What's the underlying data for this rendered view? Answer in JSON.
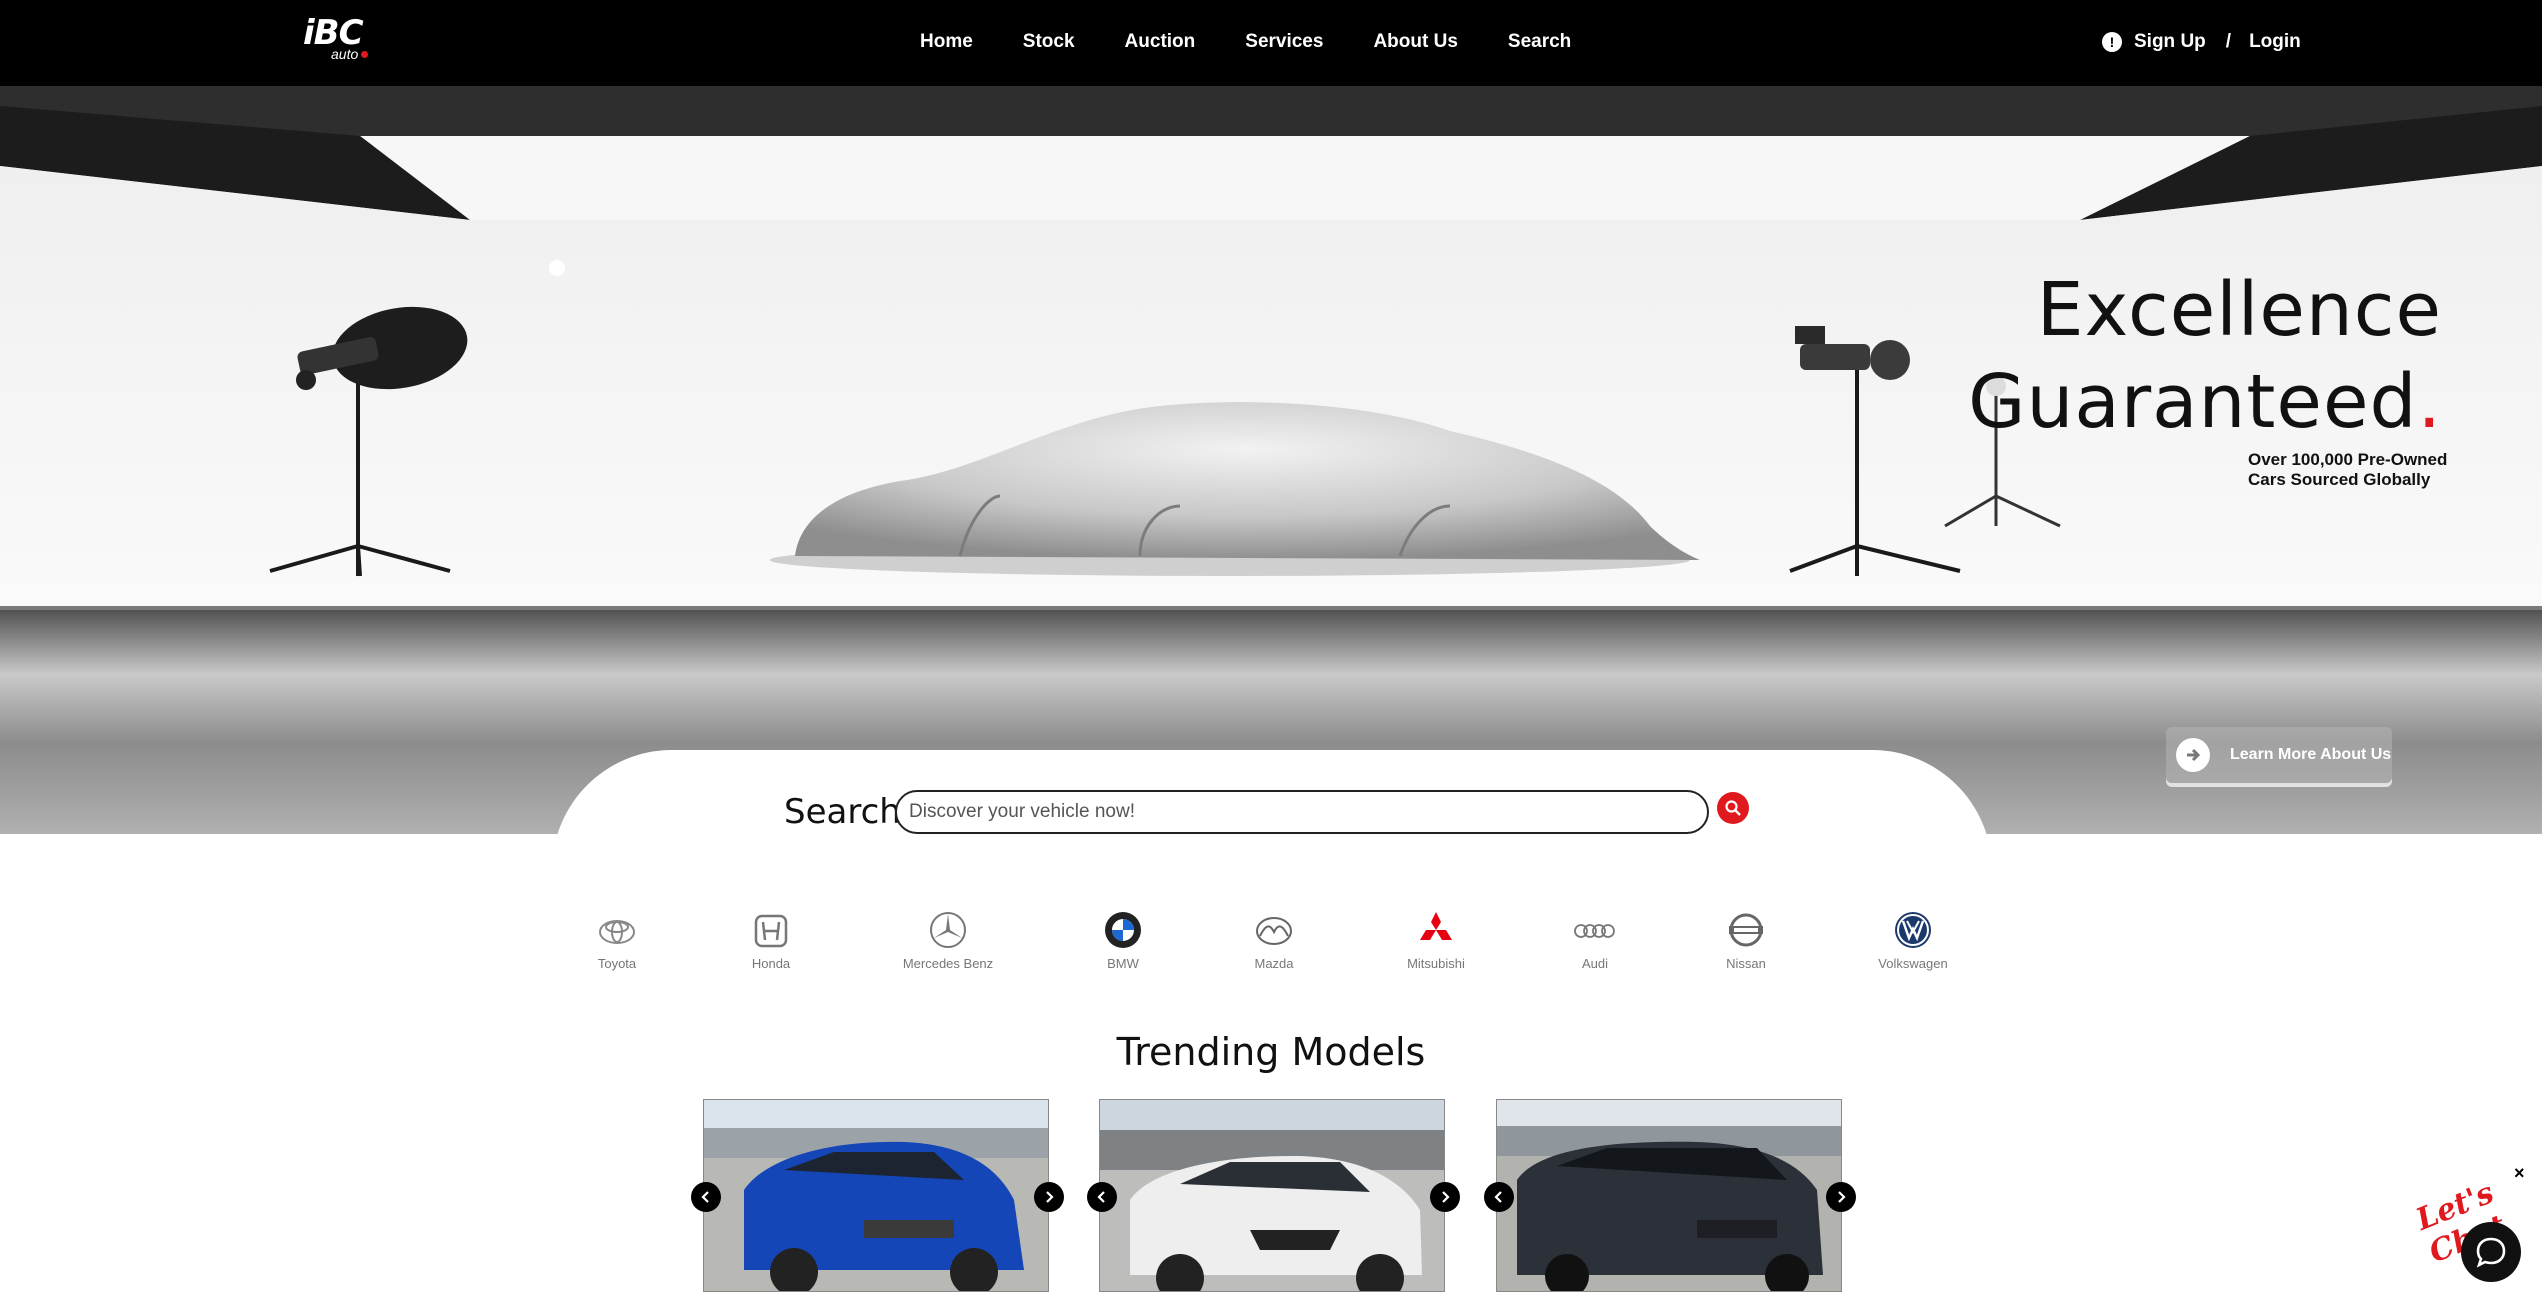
{
  "header": {
    "logo_text": "iBC",
    "logo_sub": "auto",
    "nav": [
      "Home",
      "Stock",
      "Auction",
      "Services",
      "About Us",
      "Search"
    ],
    "sign_up": "Sign Up",
    "separator": "/",
    "login": "Login"
  },
  "hero": {
    "headline_line1": "Excellence",
    "headline_line2": "Guaranteed",
    "headline_dot": ".",
    "subline": "Over 100,000 Pre-Owned Cars Sourced Globally",
    "learn_more": "Learn More About Us"
  },
  "search": {
    "label": "Search",
    "placeholder": "Discover your vehicle now!"
  },
  "brands": [
    "Toyota",
    "Honda",
    "Mercedes Benz",
    "BMW",
    "Mazda",
    "Mitsubishi",
    "Audi",
    "Nissan",
    "Volkswagen"
  ],
  "trending": {
    "title": "Trending Models"
  },
  "chat": {
    "script": "Let's Chat",
    "close": "×"
  },
  "colors": {
    "accent": "#e0191f",
    "header_bg": "#000000"
  }
}
